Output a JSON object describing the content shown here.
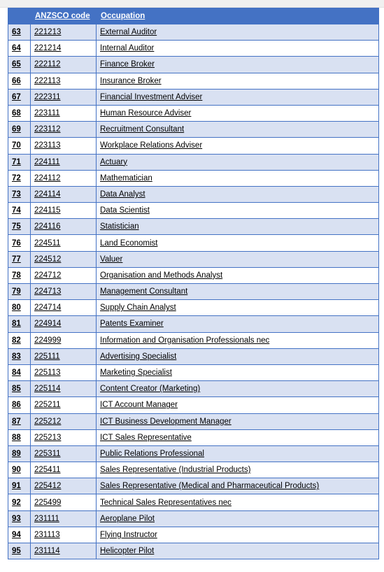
{
  "document": {
    "table": {
      "name": "anzsco-occupation-list",
      "columns": [
        {
          "key": "num",
          "header": ""
        },
        {
          "key": "code",
          "header": "ANZSCO code"
        },
        {
          "key": "occ",
          "header": "Occupation"
        }
      ],
      "header_bg": "#4472C4",
      "header_text_color": "#FFFFFF",
      "stripe_bg": "#D9E1F2",
      "plain_bg": "#FFFFFF",
      "border_color": "#4472C4",
      "rows": [
        {
          "num": "63",
          "code": "221213",
          "occ": "External Auditor"
        },
        {
          "num": "64",
          "code": "221214",
          "occ": "Internal Auditor"
        },
        {
          "num": "65",
          "code": "222112",
          "occ": "Finance Broker"
        },
        {
          "num": "66",
          "code": "222113",
          "occ": "Insurance Broker"
        },
        {
          "num": "67",
          "code": "222311",
          "occ": "Financial Investment Adviser"
        },
        {
          "num": "68",
          "code": "223111",
          "occ": "Human Resource Adviser"
        },
        {
          "num": "69",
          "code": "223112",
          "occ": "Recruitment Consultant"
        },
        {
          "num": "70",
          "code": "223113",
          "occ": "Workplace Relations Adviser"
        },
        {
          "num": "71",
          "code": "224111",
          "occ": "Actuary"
        },
        {
          "num": "72",
          "code": "224112",
          "occ": "Mathematician"
        },
        {
          "num": "73",
          "code": "224114",
          "occ": "Data Analyst"
        },
        {
          "num": "74",
          "code": "224115",
          "occ": "Data Scientist"
        },
        {
          "num": "75",
          "code": "224116",
          "occ": "Statistician"
        },
        {
          "num": "76",
          "code": "224511",
          "occ": "Land Economist"
        },
        {
          "num": "77",
          "code": "224512",
          "occ": "Valuer"
        },
        {
          "num": "78",
          "code": "224712",
          "occ": "Organisation and Methods Analyst"
        },
        {
          "num": "79",
          "code": "224713",
          "occ": "Management Consultant"
        },
        {
          "num": "80",
          "code": "224714",
          "occ": "Supply Chain Analyst"
        },
        {
          "num": "81",
          "code": "224914",
          "occ": "Patents Examiner"
        },
        {
          "num": "82",
          "code": "224999",
          "occ": "Information and Organisation Professionals nec"
        },
        {
          "num": "83",
          "code": "225111",
          "occ": "Advertising Specialist"
        },
        {
          "num": "84",
          "code": "225113",
          "occ": "Marketing Specialist"
        },
        {
          "num": "85",
          "code": "225114",
          "occ": "Content Creator (Marketing)"
        },
        {
          "num": "86",
          "code": "225211",
          "occ": "ICT Account Manager"
        },
        {
          "num": "87",
          "code": "225212",
          "occ": "ICT Business Development Manager"
        },
        {
          "num": "88",
          "code": "225213",
          "occ": "ICT Sales Representative"
        },
        {
          "num": "89",
          "code": "225311",
          "occ": "Public Relations Professional"
        },
        {
          "num": "90",
          "code": "225411",
          "occ": "Sales Representative (Industrial Products)"
        },
        {
          "num": "91",
          "code": "225412",
          "occ": "Sales Representative (Medical and Pharmaceutical Products)"
        },
        {
          "num": "92",
          "code": "225499",
          "occ": "Technical Sales Representatives nec"
        },
        {
          "num": "93",
          "code": "231111",
          "occ": "Aeroplane Pilot"
        },
        {
          "num": "94",
          "code": "231113",
          "occ": "Flying Instructor"
        },
        {
          "num": "95",
          "code": "231114",
          "occ": "Helicopter Pilot"
        }
      ]
    }
  }
}
